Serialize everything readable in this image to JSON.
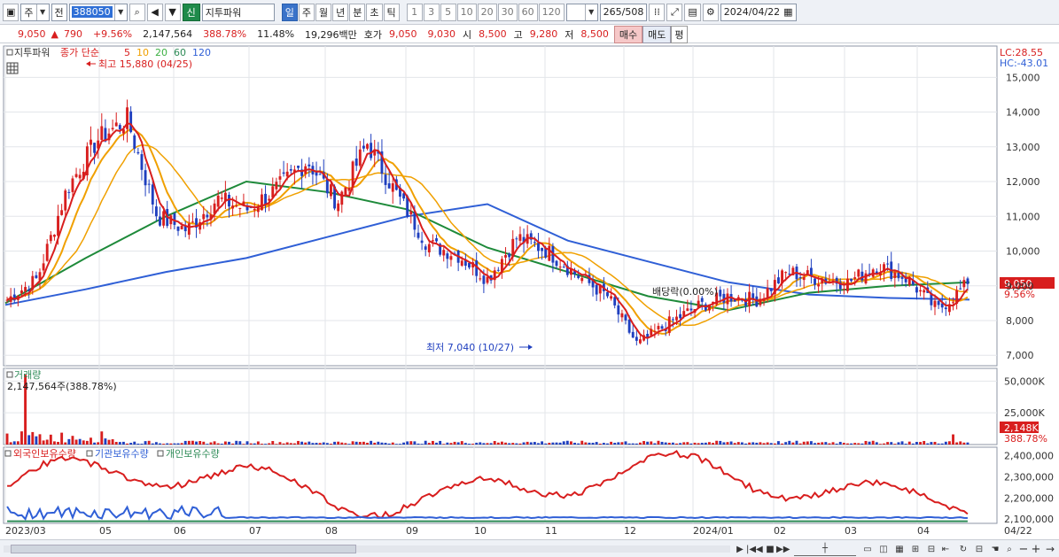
{
  "toolbar": {
    "market_label": "주",
    "prev_label": "전",
    "stock_code": "388050",
    "stock_tag": "신",
    "stock_name": "지투파워",
    "period_tabs": [
      "일",
      "주",
      "월",
      "년",
      "분",
      "초",
      "틱"
    ],
    "active_period_index": 0,
    "minute_presets": [
      "1",
      "3",
      "5",
      "10",
      "20",
      "30",
      "60",
      "120"
    ],
    "bar_count": "265",
    "bar_total": "/508",
    "date": "2024/04/22"
  },
  "infobar": {
    "price": "9,050",
    "change_arrow": "▲",
    "change": "790",
    "change_pct": "+9.56%",
    "volume": "2,147,564",
    "volume_ratio": "388.78%",
    "turnover": "11.48%",
    "trade_value": "19,296백만",
    "quote_label": "호가",
    "ask": "9,050",
    "bid": "9,030",
    "open_label": "시",
    "open": "8,500",
    "high_label": "고",
    "high": "9,280",
    "low_label": "저",
    "low": "8,500",
    "buy_label": "매수",
    "sell_label": "매도",
    "avg_label": "평"
  },
  "price_panel": {
    "title": "지투파워",
    "ma_caption": "종가 단순",
    "ma_periods": [
      "5",
      "10",
      "20",
      "60",
      "120"
    ],
    "ma_colors": [
      "#d81e1e",
      "#f0a000",
      "#3cb043",
      "#2e8b57",
      "#2f5fd6"
    ],
    "lc_label": "LC:28.55",
    "hc_label": "HC:-43.01",
    "high_annotation": "최고 15,880 (04/25)",
    "low_annotation": "최저 7,040 (10/27)",
    "dividend_annotation": "배당락(0.00%)",
    "current_price_label": "9,050",
    "current_pct_label": "9.56%",
    "y_ticks": [
      "15,000",
      "14,000",
      "13,000",
      "12,000",
      "11,000",
      "10,000",
      "9,000",
      "8,000",
      "7,000"
    ]
  },
  "volume_panel": {
    "title": "거래량",
    "readout": "2,147,564주(388.78%)",
    "y_ticks": [
      "50,000K",
      "25,000K"
    ],
    "current_label": "2,148K",
    "current_pct_label": "388.78%"
  },
  "holding_panel": {
    "legend": [
      "외국인보유수량",
      "기관보유수량",
      "개인보유수량"
    ],
    "legend_colors": [
      "#d81e1e",
      "#2f5fd6",
      "#2e8b57"
    ],
    "y_ticks": [
      "2,400,000",
      "2,300,000",
      "2,200,000",
      "2,100,000"
    ]
  },
  "x_axis": {
    "labels": [
      "2023/03",
      "05",
      "06",
      "07",
      "08",
      "09",
      "10",
      "11",
      "12",
      "2024/01",
      "02",
      "03",
      "04"
    ],
    "right_label": "04/22"
  },
  "chart_data": {
    "type": "candlestick",
    "price_range": [
      6700,
      15900
    ],
    "series_names": [
      "5",
      "10",
      "20",
      "60",
      "120"
    ],
    "approx_close_path": [
      8600,
      9200,
      11800,
      13200,
      13800,
      11000,
      10600,
      11500,
      11200,
      11800,
      12600,
      11400,
      13100,
      11600,
      10200,
      9900,
      9200,
      10400,
      10000,
      9300,
      8700,
      7300,
      7900,
      8400,
      8700,
      8600,
      9400,
      9200,
      9100,
      9600,
      9200,
      8300,
      9050
    ],
    "ma120_path": [
      8450,
      8900,
      9400,
      9800,
      10400,
      11000,
      11350,
      10300,
      9700,
      9100,
      8750,
      8650,
      8600
    ],
    "ma60_path": [
      8500,
      9800,
      11000,
      12000,
      11700,
      11200,
      10100,
      9400,
      8700,
      8300,
      8800,
      9000,
      9100
    ]
  }
}
